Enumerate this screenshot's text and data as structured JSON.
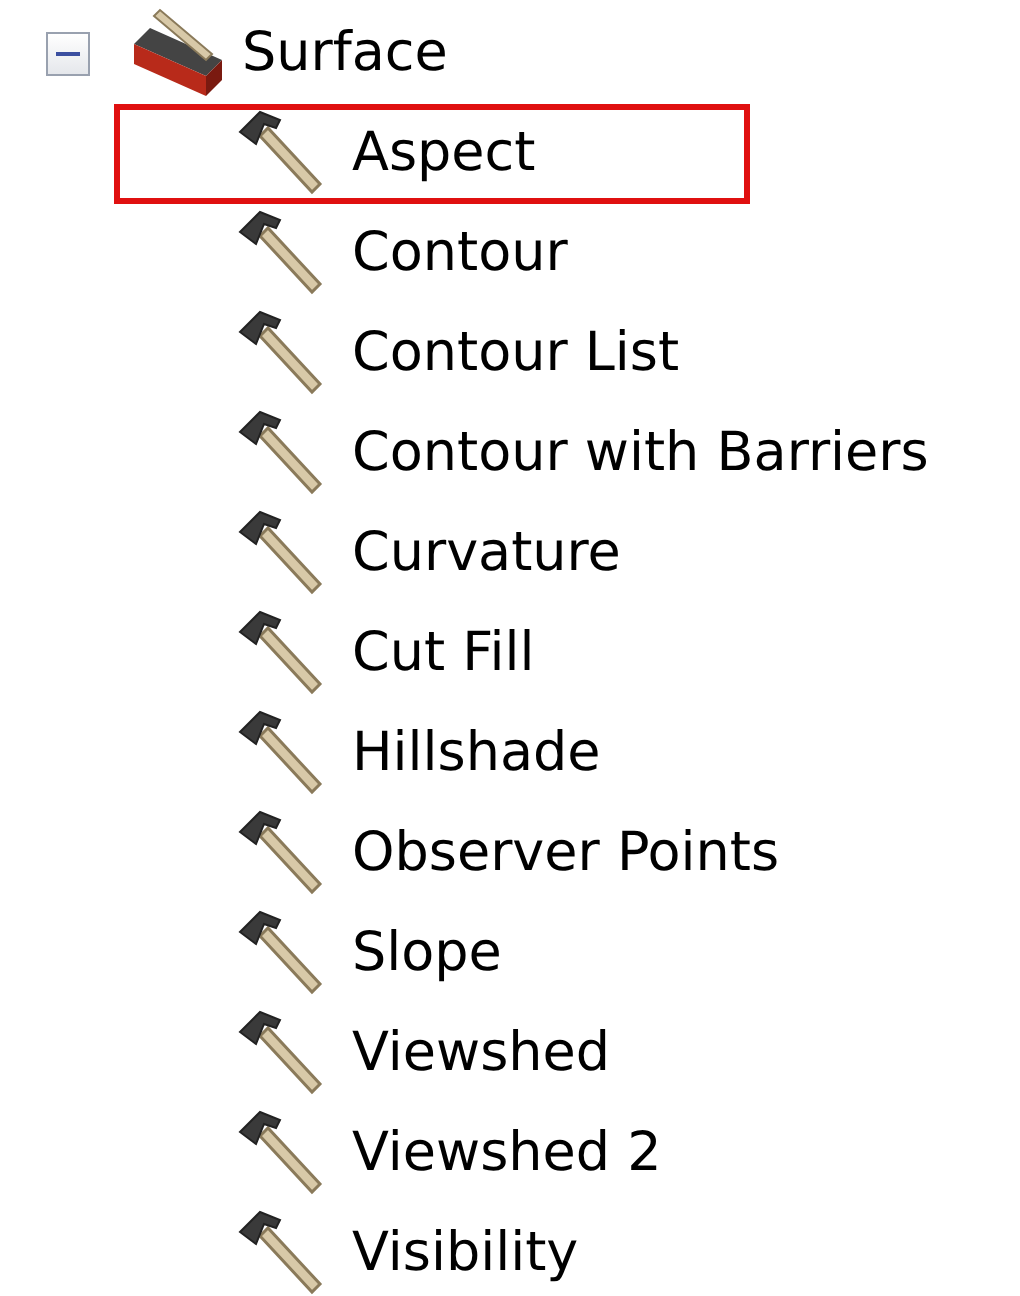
{
  "tree": [
    {
      "label": "Surface",
      "expanded": true,
      "children": [
        {
          "label": "Aspect",
          "highlighted": true
        },
        {
          "label": "Contour",
          "highlighted": false
        },
        {
          "label": "Contour List",
          "highlighted": false
        },
        {
          "label": "Contour with Barriers",
          "highlighted": false
        },
        {
          "label": "Curvature",
          "highlighted": false
        },
        {
          "label": "Cut Fill",
          "highlighted": false
        },
        {
          "label": "Hillshade",
          "highlighted": false
        },
        {
          "label": "Observer Points",
          "highlighted": false
        },
        {
          "label": "Slope",
          "highlighted": false
        },
        {
          "label": "Viewshed",
          "highlighted": false
        },
        {
          "label": "Viewshed 2",
          "highlighted": false
        },
        {
          "label": "Visibility",
          "highlighted": false
        }
      ]
    }
  ]
}
